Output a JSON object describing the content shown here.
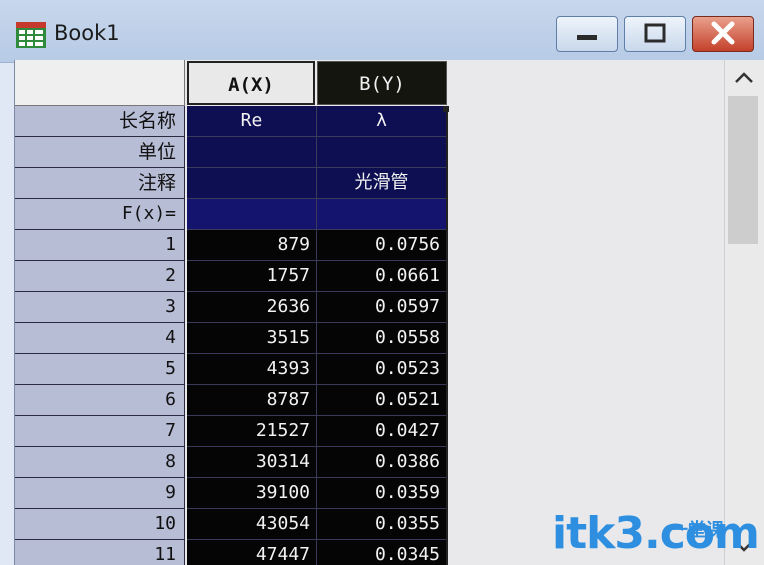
{
  "window": {
    "title": "Book1"
  },
  "columns": {
    "a": "A(X)",
    "b": "B(Y)"
  },
  "meta_rows": [
    {
      "label": "长名称",
      "a": "Re",
      "b": "λ"
    },
    {
      "label": "单位",
      "a": "",
      "b": ""
    },
    {
      "label": "注释",
      "a": "",
      "b": "光滑管"
    },
    {
      "label": "F(x)=",
      "a": "",
      "b": ""
    }
  ],
  "rows": [
    {
      "n": "1",
      "a": "879",
      "b": "0.0756"
    },
    {
      "n": "2",
      "a": "1757",
      "b": "0.0661"
    },
    {
      "n": "3",
      "a": "2636",
      "b": "0.0597"
    },
    {
      "n": "4",
      "a": "3515",
      "b": "0.0558"
    },
    {
      "n": "5",
      "a": "4393",
      "b": "0.0523"
    },
    {
      "n": "6",
      "a": "8787",
      "b": "0.0521"
    },
    {
      "n": "7",
      "a": "21527",
      "b": "0.0427"
    },
    {
      "n": "8",
      "a": "30314",
      "b": "0.0386"
    },
    {
      "n": "9",
      "a": "39100",
      "b": "0.0359"
    },
    {
      "n": "10",
      "a": "43054",
      "b": "0.0355"
    },
    {
      "n": "11",
      "a": "47447",
      "b": "0.0345"
    }
  ],
  "watermark": {
    "main": "itk3.com",
    "sub": "一堂课"
  },
  "colors": {
    "titlebar": "#c7d7ec",
    "row_header": "#b8bdd6",
    "meta_cell": "#0e0e52",
    "data_cell": "#050505",
    "watermark": "#2e8fe0"
  },
  "icons": {
    "app": "worksheet-icon",
    "minimize": "minimize-icon",
    "maximize": "maximize-icon",
    "close": "close-icon"
  }
}
